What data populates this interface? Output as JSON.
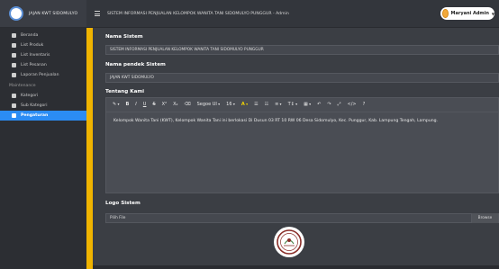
{
  "header": {
    "brand_name": "JAJAN KWT SIDOMULYO",
    "title": "SISTEM INFORMASI PENJUALAN KELOMPOK WANITA TANI SIDOMULYO PUNGGUR - Admin",
    "user_name": "Maryani Admin"
  },
  "sidebar": {
    "items": [
      {
        "label": "Beranda",
        "icon": "dashboard-icon"
      },
      {
        "label": "List Produk",
        "icon": "list-icon"
      },
      {
        "label": "List Inventaris",
        "icon": "list-icon"
      },
      {
        "label": "List Pesanan",
        "icon": "list-icon"
      },
      {
        "label": "Laporan Penjualan",
        "icon": "report-icon"
      }
    ],
    "section_heading": "Maintenance",
    "maintenance_items": [
      {
        "label": "Kategori",
        "icon": "table-icon"
      },
      {
        "label": "Sub Kategori",
        "icon": "table-icon"
      },
      {
        "label": "Pengaturan",
        "icon": "gears-icon",
        "active": true
      }
    ]
  },
  "form": {
    "system_name_label": "Nama Sistem",
    "system_name_value": "SISTEM INFORMASI PENJUALAN KELOMPOK WANITA TANI SIDOMULYO PUNGGUR",
    "short_name_label": "Nama pendek Sistem",
    "short_name_value": "JAJAN KWT SIDOMULYO",
    "about_label": "Tentang Kami",
    "about_content": "Kelompok Wanita Tani (KWT), Kelompok Wanita Tani ini berlokasi Di Dusun 03 RT 10 RW 06 Desa Sidomulyo, Kec. Punggur, Kab. Lampung Tengah, Lampung.",
    "logo_label": "Logo Sistem",
    "file_placeholder": "Pilih File",
    "browse_label": "Browse"
  },
  "toolbar": {
    "font_name": "Segoe UI",
    "font_size": "16"
  },
  "colors": {
    "accent": "#f0b400",
    "active_nav": "#2b8cf4",
    "panel_bg": "#3b3e44",
    "sidebar_bg": "#2c2e33"
  }
}
